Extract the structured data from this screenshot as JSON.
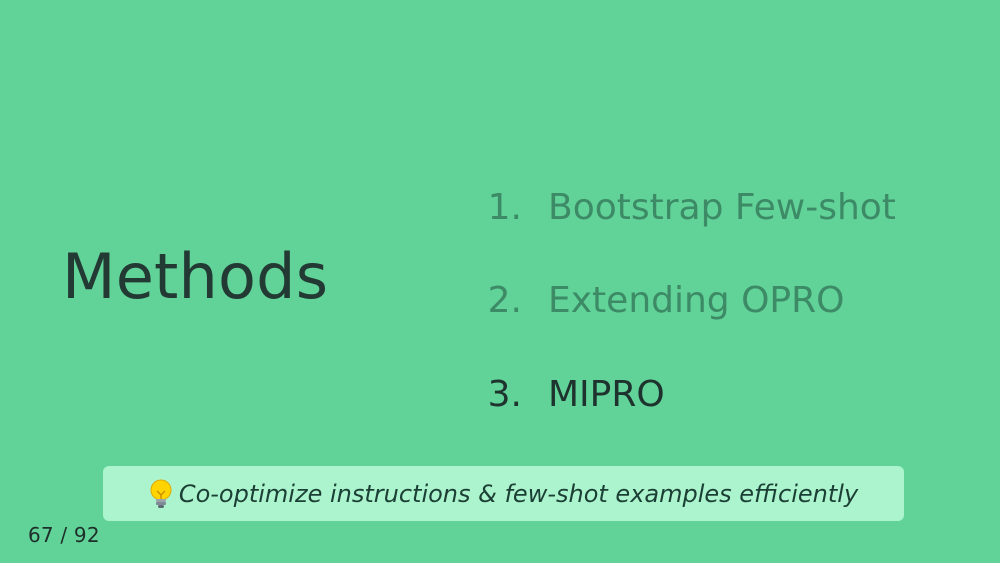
{
  "slide": {
    "title": "Methods",
    "list": [
      {
        "number": "1.",
        "label": "Bootstrap Few-shot",
        "state": "dim"
      },
      {
        "number": "2.",
        "label": "Extending OPRO",
        "state": "dim"
      },
      {
        "number": "3.",
        "label": "MIPRO",
        "state": "active"
      }
    ],
    "callout": {
      "icon": "lightbulb-icon",
      "text": "Co-optimize instructions & few-shot examples efficiently"
    },
    "page_indicator": "67 / 92"
  },
  "colors": {
    "background": "#61d398",
    "title": "#233a34",
    "dim_item": "#3d8a66",
    "active_item": "#1e332e",
    "callout_bg": "#abf4cd"
  }
}
